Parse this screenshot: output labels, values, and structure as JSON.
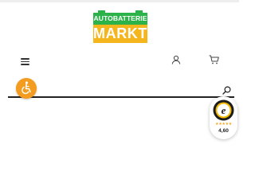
{
  "logo": {
    "top_text": "AUTOBATTERIE",
    "bottom_text": "MARKT",
    "colors": {
      "top": "#2bb34a",
      "bottom": "#f5b51c"
    }
  },
  "header": {
    "menu_icon": "hamburger-menu-icon",
    "account_icon": "user-icon",
    "cart_icon": "shopping-cart-icon"
  },
  "search": {
    "value": "",
    "placeholder": "",
    "icon": "search-icon"
  },
  "accessibility": {
    "icon": "wheelchair-icon",
    "color": "#f39c1f"
  },
  "trust_badge": {
    "icon": "trusted-shops-e-icon",
    "stars": "★★★★★",
    "rating": "4,60"
  }
}
